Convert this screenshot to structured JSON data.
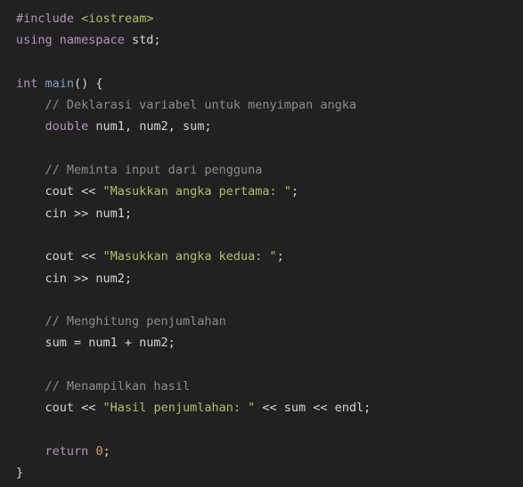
{
  "editor": {
    "language": "C++",
    "theme": "dark",
    "background_color": "#212121",
    "default_text_color": "#d4d4d4",
    "colors": {
      "keyword": "#b294bb",
      "function": "#81a2be",
      "string": "#b5bd68",
      "header": "#b5bd68",
      "comment": "#8c8c8c",
      "number": "#de935f",
      "plain": "#d4d4d4"
    }
  },
  "code": {
    "lines": [
      {
        "id": 1,
        "indent": 0,
        "tokens": [
          {
            "t": "#include",
            "c": "kw"
          },
          {
            "t": " ",
            "c": "plain"
          },
          {
            "t": "<iostream>",
            "c": "hdr"
          }
        ]
      },
      {
        "id": 2,
        "indent": 0,
        "tokens": [
          {
            "t": "using namespace",
            "c": "kw"
          },
          {
            "t": " std;",
            "c": "plain"
          }
        ]
      },
      {
        "id": 3,
        "indent": 0,
        "tokens": []
      },
      {
        "id": 4,
        "indent": 0,
        "tokens": [
          {
            "t": "int",
            "c": "kw"
          },
          {
            "t": " ",
            "c": "plain"
          },
          {
            "t": "main",
            "c": "fn"
          },
          {
            "t": "() {",
            "c": "punct"
          }
        ]
      },
      {
        "id": 5,
        "indent": 1,
        "tokens": [
          {
            "t": "// Deklarasi variabel untuk menyimpan angka",
            "c": "cmt"
          }
        ]
      },
      {
        "id": 6,
        "indent": 1,
        "tokens": [
          {
            "t": "double",
            "c": "kw"
          },
          {
            "t": " num1, num2, sum;",
            "c": "plain"
          }
        ]
      },
      {
        "id": 7,
        "indent": 0,
        "tokens": []
      },
      {
        "id": 8,
        "indent": 1,
        "tokens": [
          {
            "t": "// Meminta input dari pengguna",
            "c": "cmt"
          }
        ]
      },
      {
        "id": 9,
        "indent": 1,
        "tokens": [
          {
            "t": "cout << ",
            "c": "plain"
          },
          {
            "t": "\"Masukkan angka pertama: \"",
            "c": "str"
          },
          {
            "t": ";",
            "c": "plain"
          }
        ]
      },
      {
        "id": 10,
        "indent": 1,
        "tokens": [
          {
            "t": "cin >> num1;",
            "c": "plain"
          }
        ]
      },
      {
        "id": 11,
        "indent": 0,
        "tokens": []
      },
      {
        "id": 12,
        "indent": 1,
        "tokens": [
          {
            "t": "cout << ",
            "c": "plain"
          },
          {
            "t": "\"Masukkan angka kedua: \"",
            "c": "str"
          },
          {
            "t": ";",
            "c": "plain"
          }
        ]
      },
      {
        "id": 13,
        "indent": 1,
        "tokens": [
          {
            "t": "cin >> num2;",
            "c": "plain"
          }
        ]
      },
      {
        "id": 14,
        "indent": 0,
        "tokens": []
      },
      {
        "id": 15,
        "indent": 1,
        "tokens": [
          {
            "t": "// Menghitung penjumlahan",
            "c": "cmt"
          }
        ]
      },
      {
        "id": 16,
        "indent": 1,
        "tokens": [
          {
            "t": "sum = num1 + num2;",
            "c": "plain"
          }
        ]
      },
      {
        "id": 17,
        "indent": 0,
        "tokens": []
      },
      {
        "id": 18,
        "indent": 1,
        "tokens": [
          {
            "t": "// Menampilkan hasil",
            "c": "cmt"
          }
        ]
      },
      {
        "id": 19,
        "indent": 1,
        "tokens": [
          {
            "t": "cout << ",
            "c": "plain"
          },
          {
            "t": "\"Hasil penjumlahan: \"",
            "c": "str"
          },
          {
            "t": " << sum << endl;",
            "c": "plain"
          }
        ]
      },
      {
        "id": 20,
        "indent": 0,
        "tokens": []
      },
      {
        "id": 21,
        "indent": 1,
        "tokens": [
          {
            "t": "return",
            "c": "kw"
          },
          {
            "t": " ",
            "c": "plain"
          },
          {
            "t": "0",
            "c": "num"
          },
          {
            "t": ";",
            "c": "plain"
          }
        ]
      },
      {
        "id": 22,
        "indent": 0,
        "tokens": [
          {
            "t": "}",
            "c": "punct"
          }
        ]
      }
    ]
  }
}
